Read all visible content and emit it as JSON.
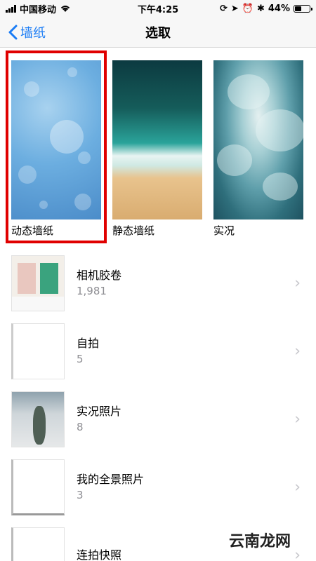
{
  "status_bar": {
    "carrier": "中国移动",
    "time": "下午4:25",
    "battery": "44%",
    "battery_level": 0.44
  },
  "nav": {
    "back_label": "墙纸",
    "title": "选取"
  },
  "categories": [
    {
      "label": "动态墙纸"
    },
    {
      "label": "静态墙纸"
    },
    {
      "label": "实况"
    }
  ],
  "albums": [
    {
      "name": "相机胶卷",
      "count": "1,981"
    },
    {
      "name": "自拍",
      "count": "5"
    },
    {
      "name": "实况照片",
      "count": "8"
    },
    {
      "name": "我的全景照片",
      "count": "3"
    },
    {
      "name": "连拍快照",
      "count": ""
    }
  ],
  "watermark": "云南龙网",
  "colors": {
    "accent": "#1a7cf5",
    "highlight": "#e00000"
  }
}
